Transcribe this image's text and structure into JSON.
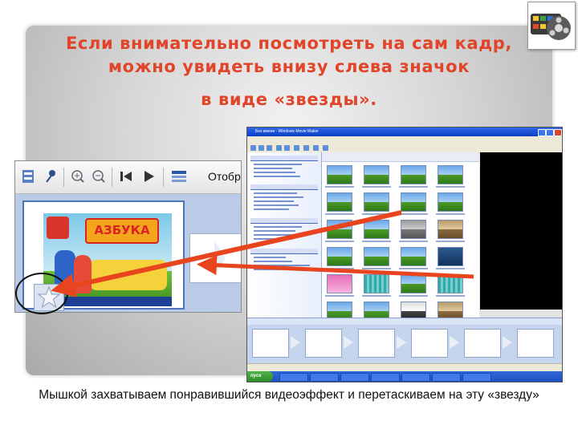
{
  "slide": {
    "title_line1": "Если внимательно посмотреть на сам кадр,",
    "title_line2": "можно увидеть внизу слева значок",
    "title_line3": "в виде «звезды».",
    "caption": "Мышкой захватываем понравившийся видеоэффект и перетаскиваем на эту «звезду»",
    "title_color": "#e0452a",
    "arrow_color": "#e8451f"
  },
  "logo": {
    "icon": "movie-maker-film-reel-icon"
  },
  "zoom_view": {
    "toolbar_label": "Отображе",
    "clip_sign_text": "АЗБУКА",
    "star_icon": "effect-star-icon"
  },
  "movie_maker": {
    "window_title": "Без имени - Windows Movie Maker",
    "start_label": "пуск"
  }
}
